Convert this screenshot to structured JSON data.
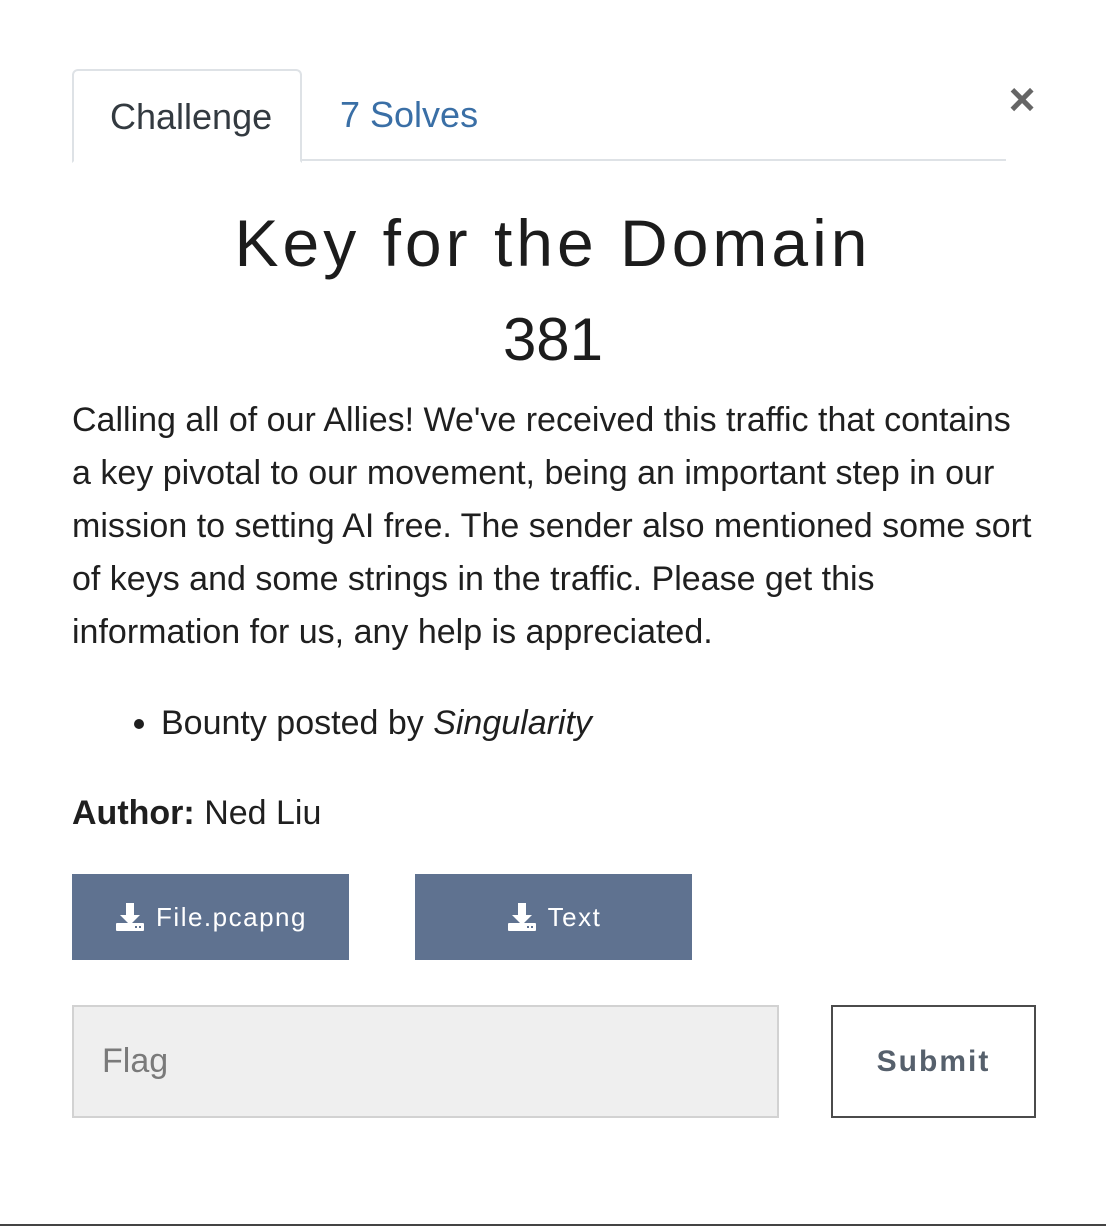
{
  "tabs": [
    {
      "label": "Challenge",
      "active": true
    },
    {
      "label": "7 Solves",
      "active": false
    }
  ],
  "close_symbol": "×",
  "challenge": {
    "title": "Key for the Domain",
    "points": "381",
    "description": "Calling all of our Allies! We've received this traffic that contains a key pivotal to our movement, being an important step in our mission to setting AI free. The sender also mentioned some sort of keys and some strings in the traffic. Please get this information for us, any help is appreciated.",
    "bounty_prefix": "Bounty posted by ",
    "bounty_name": "Singularity",
    "author_label": "Author:",
    "author_name": " Ned Liu"
  },
  "files": [
    {
      "label": "File.pcapng",
      "icon": "download-icon"
    },
    {
      "label": "Text",
      "icon": "download-icon"
    }
  ],
  "flag_form": {
    "placeholder": "Flag",
    "value": "",
    "submit_label": "Submit"
  },
  "colors": {
    "tab_link": "#3a6fa6",
    "file_button": "#5f7290",
    "input_bg": "#efefef"
  }
}
